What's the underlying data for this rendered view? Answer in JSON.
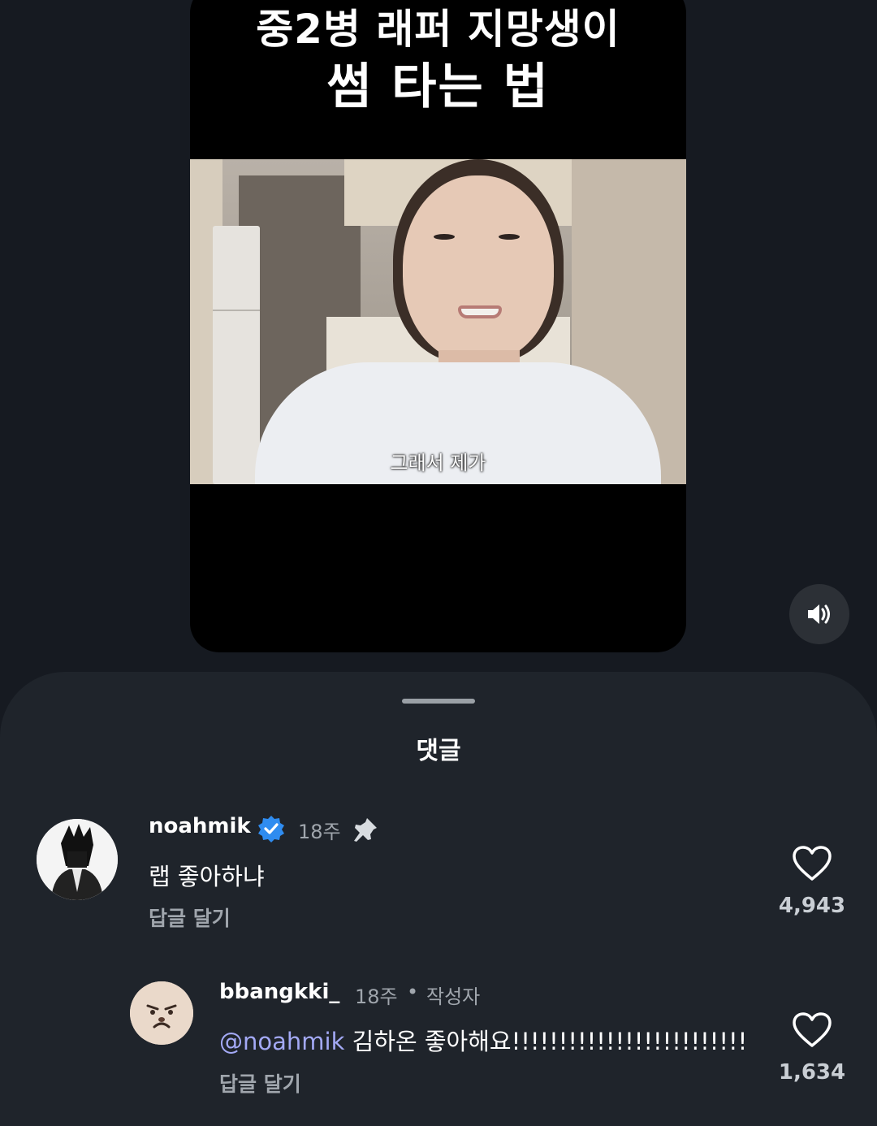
{
  "video": {
    "title_line1": "중2병 래퍼 지망생이",
    "title_line2": "썸 타는 법",
    "subtitle": "그래서 제가"
  },
  "sound_button": {
    "icon": "speaker-icon"
  },
  "comments_sheet": {
    "title": "댓글",
    "comments": [
      {
        "username": "noahmik",
        "verified": true,
        "time": "18주",
        "pinned": true,
        "text": "랩 좋아하냐",
        "reply_label": "답글 달기",
        "likes": "4,943"
      },
      {
        "username": "bbangkki_",
        "time": "18주",
        "separator": "•",
        "author_badge": "작성자",
        "mention": "@noahmik",
        "text": " 김하온 좋아해요!!!!!!!!!!!!!!!!!!!!!!!!!",
        "reply_label": "답글 달기",
        "likes": "1,634"
      }
    ]
  },
  "colors": {
    "background": "#161a21",
    "sheet": "#1f242b",
    "mention": "#a3a9f5",
    "verified": "#2f8cf0",
    "muted": "#a0a6ad"
  }
}
